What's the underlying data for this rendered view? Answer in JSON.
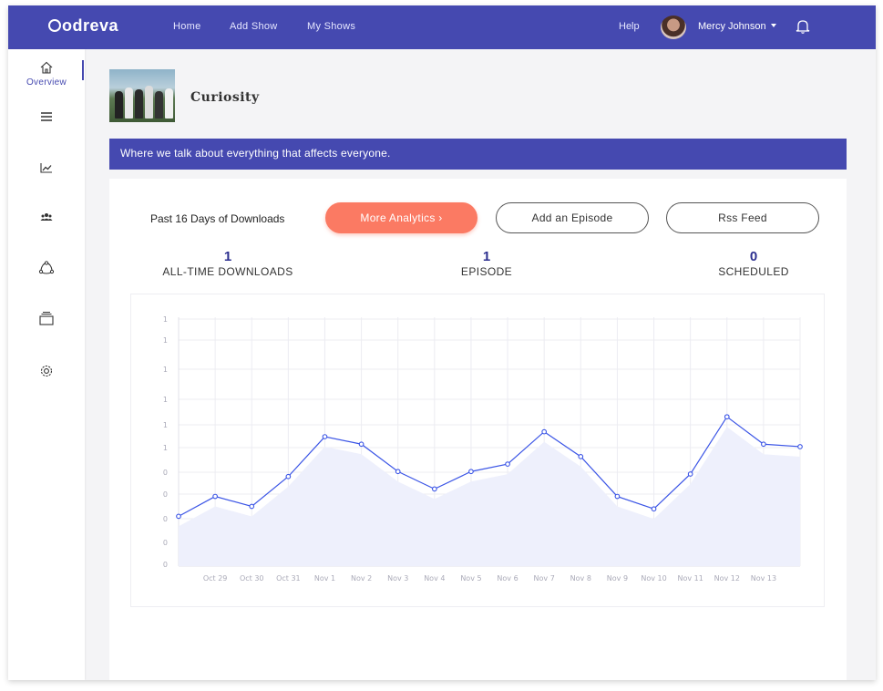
{
  "app": {
    "logo": "odreva",
    "nav": [
      "Home",
      "Add Show",
      "My Shows"
    ],
    "help": "Help",
    "user_name": "Mercy Johnson"
  },
  "sidebar": {
    "items": [
      {
        "icon": "home-icon",
        "label": "Overview",
        "active": true
      },
      {
        "icon": "list-icon",
        "label": ""
      },
      {
        "icon": "analytics-icon",
        "label": ""
      },
      {
        "icon": "users-icon",
        "label": ""
      },
      {
        "icon": "network-icon",
        "label": ""
      },
      {
        "icon": "layers-icon",
        "label": ""
      },
      {
        "icon": "settings-icon",
        "label": ""
      }
    ]
  },
  "show": {
    "title": "Curiosity",
    "description": "Where we talk about everything that affects everyone."
  },
  "downloads": {
    "period_label": "Past 16  Days of Downloads",
    "more_analytics": "More Analytics ›",
    "add_episode": "Add an Episode",
    "rss_feed": "Rss Feed"
  },
  "stats": [
    {
      "value": "1",
      "label": "ALL-TIME DOWNLOADS"
    },
    {
      "value": "1",
      "label": "EPISODE"
    },
    {
      "value": "0",
      "label": "SCHEDULED"
    }
  ],
  "chart_data": {
    "type": "line",
    "categories": [
      "",
      "Oct 29",
      "Oct 30",
      "Oct 31",
      "Nov 1",
      "Nov 2",
      "Nov 3",
      "Nov 4",
      "Nov 5",
      "Nov 6",
      "Nov 7",
      "Nov 8",
      "Nov 9",
      "Nov 10",
      "Nov 11",
      "Nov 12",
      "Nov 13",
      ""
    ],
    "y_tick_labels": [
      "1",
      "1",
      "1",
      "1",
      "1",
      "1",
      "0",
      "0",
      "0",
      "0",
      "0"
    ],
    "series": [
      {
        "values": [
          0.2,
          0.28,
          0.24,
          0.36,
          0.52,
          0.49,
          0.38,
          0.31,
          0.38,
          0.41,
          0.54,
          0.44,
          0.28,
          0.23,
          0.37,
          0.6,
          0.49,
          0.48
        ]
      }
    ],
    "ylim": [
      0,
      1
    ],
    "grid": true,
    "line_color": "#3b55e6",
    "fill_color": "#eef0fc"
  },
  "colors": {
    "brand": "#4549b0",
    "accent": "#fb7a63",
    "stat_number": "#2c2f8f"
  }
}
